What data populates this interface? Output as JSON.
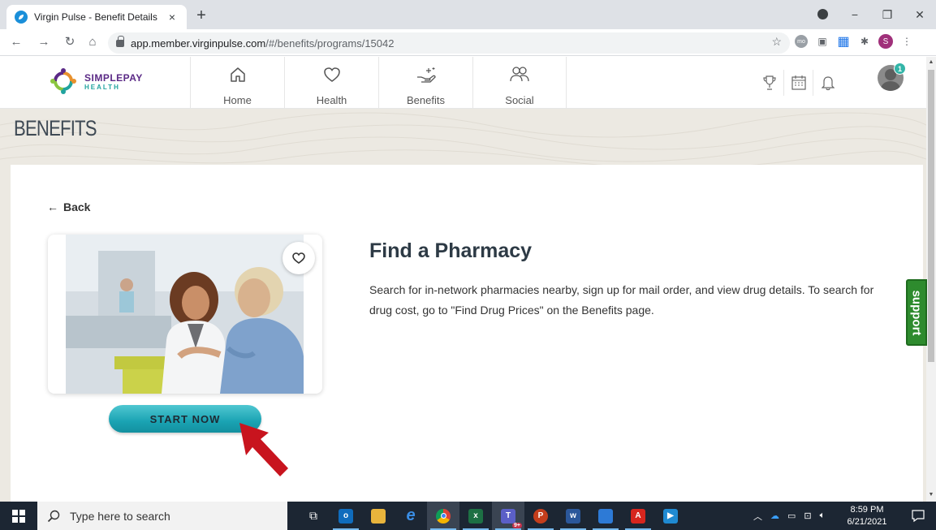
{
  "browser": {
    "tab_title": "Virgin Pulse - Benefit Details",
    "tab_close": "×",
    "new_tab": "+",
    "url_host": "app.member.virginpulse.com",
    "url_path": "/#/benefits/programs/15042",
    "profile_initial": "S",
    "ext_label": "mo",
    "window_controls": {
      "minimize": "−",
      "restore": "❐",
      "close": "✕"
    }
  },
  "header": {
    "logo_name": "SIMPLEPAY",
    "logo_sub": "HEALTH",
    "nav": [
      {
        "label": "Home",
        "icon": "home-icon"
      },
      {
        "label": "Health",
        "icon": "heart-icon"
      },
      {
        "label": "Benefits",
        "icon": "hand-sparkle-icon"
      },
      {
        "label": "Social",
        "icon": "people-icon"
      }
    ],
    "notification_count": "1"
  },
  "page": {
    "title": "BENEFITS",
    "back_label": "Back",
    "program_title": "Find a Pharmacy",
    "program_description": "Search for in-network pharmacies nearby, sign up for mail order, and view drug details. To search for drug cost, go to \"Find Drug Prices\" on the Benefits page.",
    "start_button": "START NOW",
    "support_label": "support"
  },
  "taskbar": {
    "search_placeholder": "Type here to search",
    "time": "8:59 PM",
    "date": "6/21/2021",
    "teams_badge": "9+"
  },
  "colors": {
    "accent_teal": "#1aa3b3",
    "support_green": "#2e8b2e",
    "arrow_red": "#c8141e",
    "logo_purple": "#5b2a86"
  }
}
